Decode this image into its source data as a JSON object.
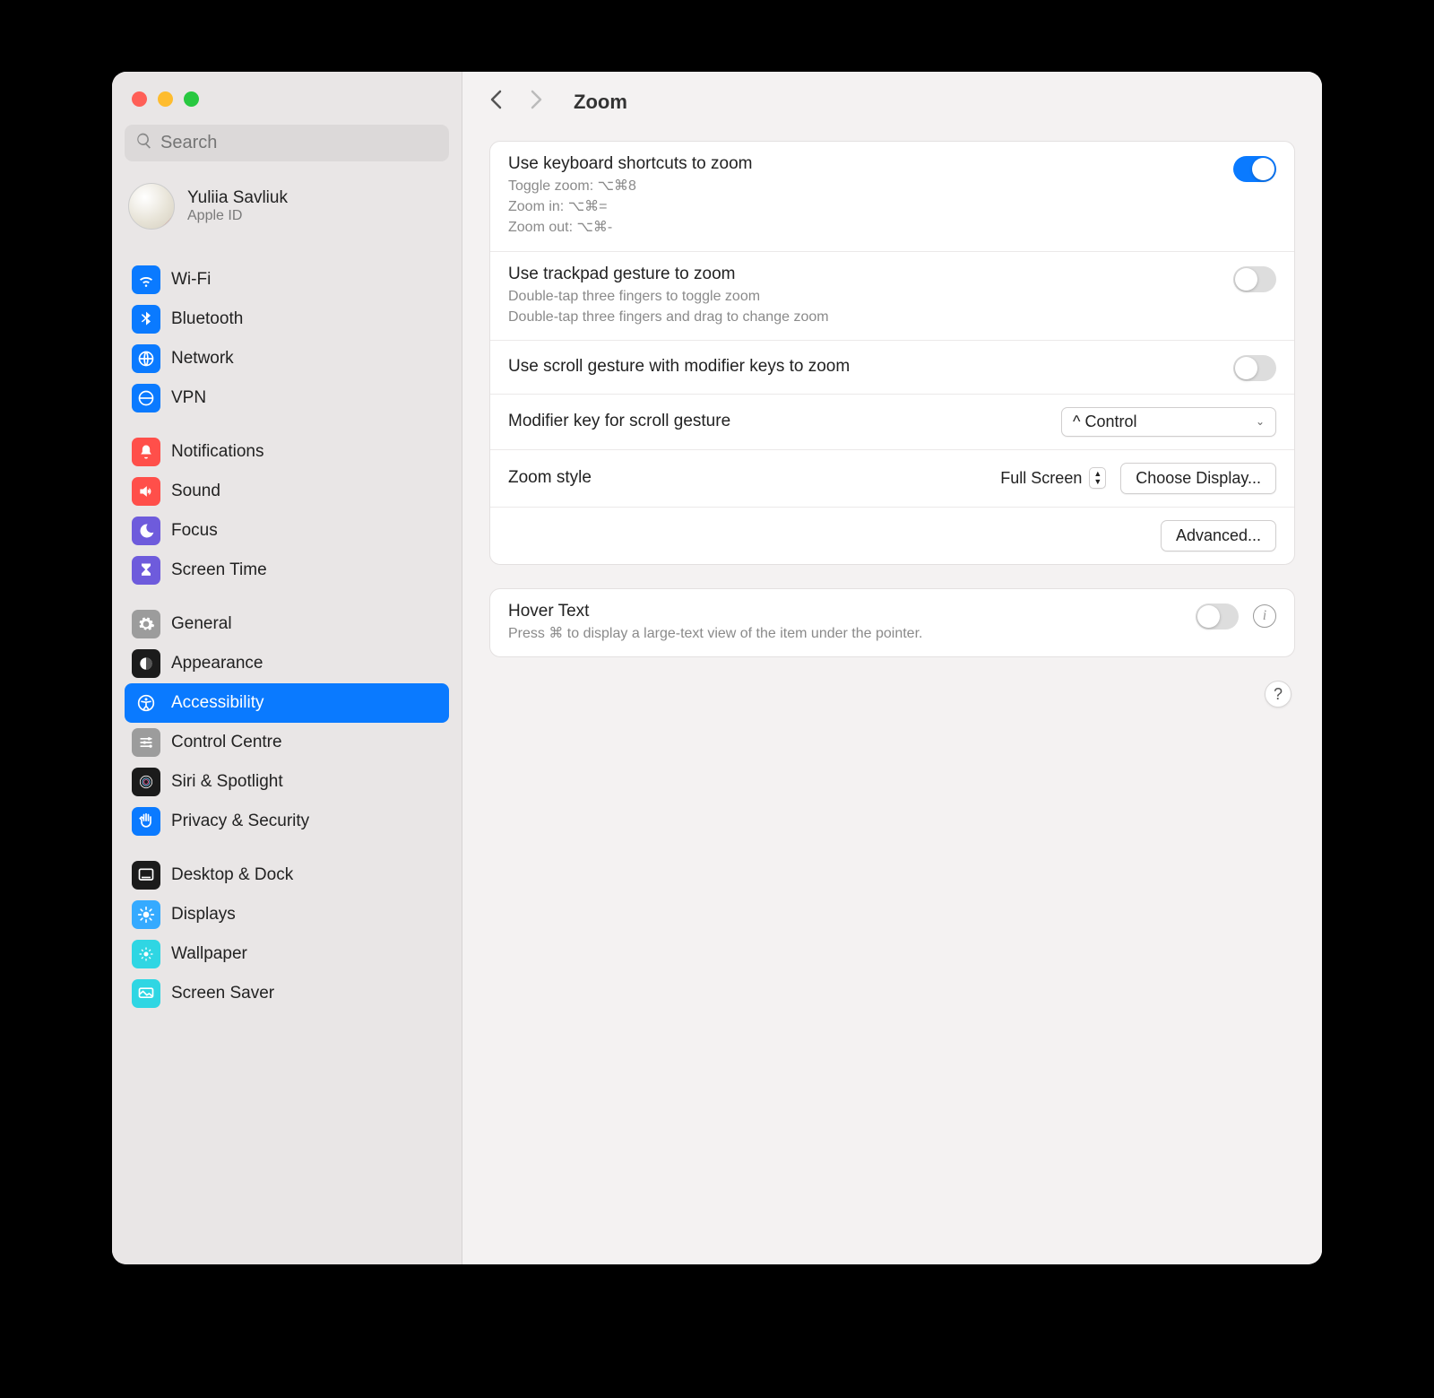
{
  "search_placeholder": "Search",
  "account": {
    "name": "Yuliia Savliuk",
    "sub": "Apple ID"
  },
  "sidebar": {
    "groups": [
      [
        {
          "label": "Wi-Fi",
          "icon": "wifi-icon",
          "color": "#0a7aff"
        },
        {
          "label": "Bluetooth",
          "icon": "bluetooth-icon",
          "color": "#0a7aff"
        },
        {
          "label": "Network",
          "icon": "network-icon",
          "color": "#0a7aff"
        },
        {
          "label": "VPN",
          "icon": "vpn-icon",
          "color": "#0a7aff"
        }
      ],
      [
        {
          "label": "Notifications",
          "icon": "bell-icon",
          "color": "#ff4f4a"
        },
        {
          "label": "Sound",
          "icon": "sound-icon",
          "color": "#ff4f4a"
        },
        {
          "label": "Focus",
          "icon": "moon-icon",
          "color": "#6e5bdc"
        },
        {
          "label": "Screen Time",
          "icon": "hourglass-icon",
          "color": "#6e5bdc"
        }
      ],
      [
        {
          "label": "General",
          "icon": "gear-icon",
          "color": "#9c9c9c"
        },
        {
          "label": "Appearance",
          "icon": "appearance-icon",
          "color": "#1b1b1b"
        },
        {
          "label": "Accessibility",
          "icon": "accessibility-icon",
          "color": "#0a7aff",
          "active": true
        },
        {
          "label": "Control Centre",
          "icon": "sliders-icon",
          "color": "#9c9c9c"
        },
        {
          "label": "Siri & Spotlight",
          "icon": "siri-icon",
          "color": "#1b1b1b"
        },
        {
          "label": "Privacy & Security",
          "icon": "hand-icon",
          "color": "#0a7aff"
        }
      ],
      [
        {
          "label": "Desktop & Dock",
          "icon": "dock-icon",
          "color": "#1b1b1b"
        },
        {
          "label": "Displays",
          "icon": "displays-icon",
          "color": "#35aaff"
        },
        {
          "label": "Wallpaper",
          "icon": "wallpaper-icon",
          "color": "#2fd6e3"
        },
        {
          "label": "Screen Saver",
          "icon": "screensaver-icon",
          "color": "#2fd6e3"
        }
      ]
    ]
  },
  "title": "Zoom",
  "settings": {
    "keyboard": {
      "title": "Use keyboard shortcuts to zoom",
      "sub1": "Toggle zoom: ⌥⌘8",
      "sub2": "Zoom in: ⌥⌘=",
      "sub3": "Zoom out: ⌥⌘-",
      "on": true
    },
    "trackpad": {
      "title": "Use trackpad gesture to zoom",
      "sub1": "Double-tap three fingers to toggle zoom",
      "sub2": "Double-tap three fingers and drag to change zoom",
      "on": false
    },
    "scroll": {
      "title": "Use scroll gesture with modifier keys to zoom",
      "on": false
    },
    "modifier": {
      "title": "Modifier key for scroll gesture",
      "value": "^ Control"
    },
    "style": {
      "title": "Zoom style",
      "value": "Full Screen",
      "button": "Choose Display..."
    },
    "advanced": "Advanced...",
    "hover": {
      "title": "Hover Text",
      "sub": "Press ⌘ to display a large-text view of the item under the pointer.",
      "on": false
    }
  },
  "help": "?"
}
